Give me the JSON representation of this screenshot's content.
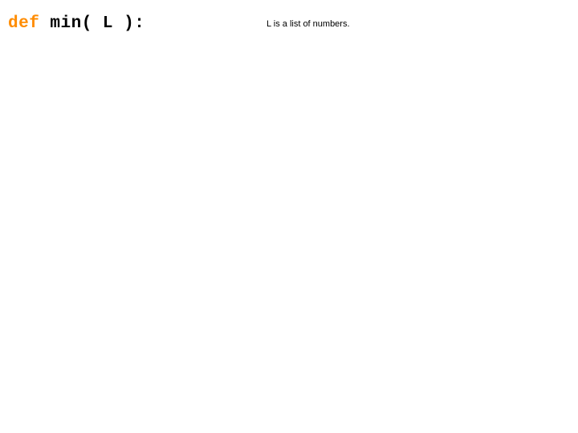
{
  "code": {
    "keyword": "def",
    "rest": " min( L ):"
  },
  "annotation": "L is a list of numbers."
}
